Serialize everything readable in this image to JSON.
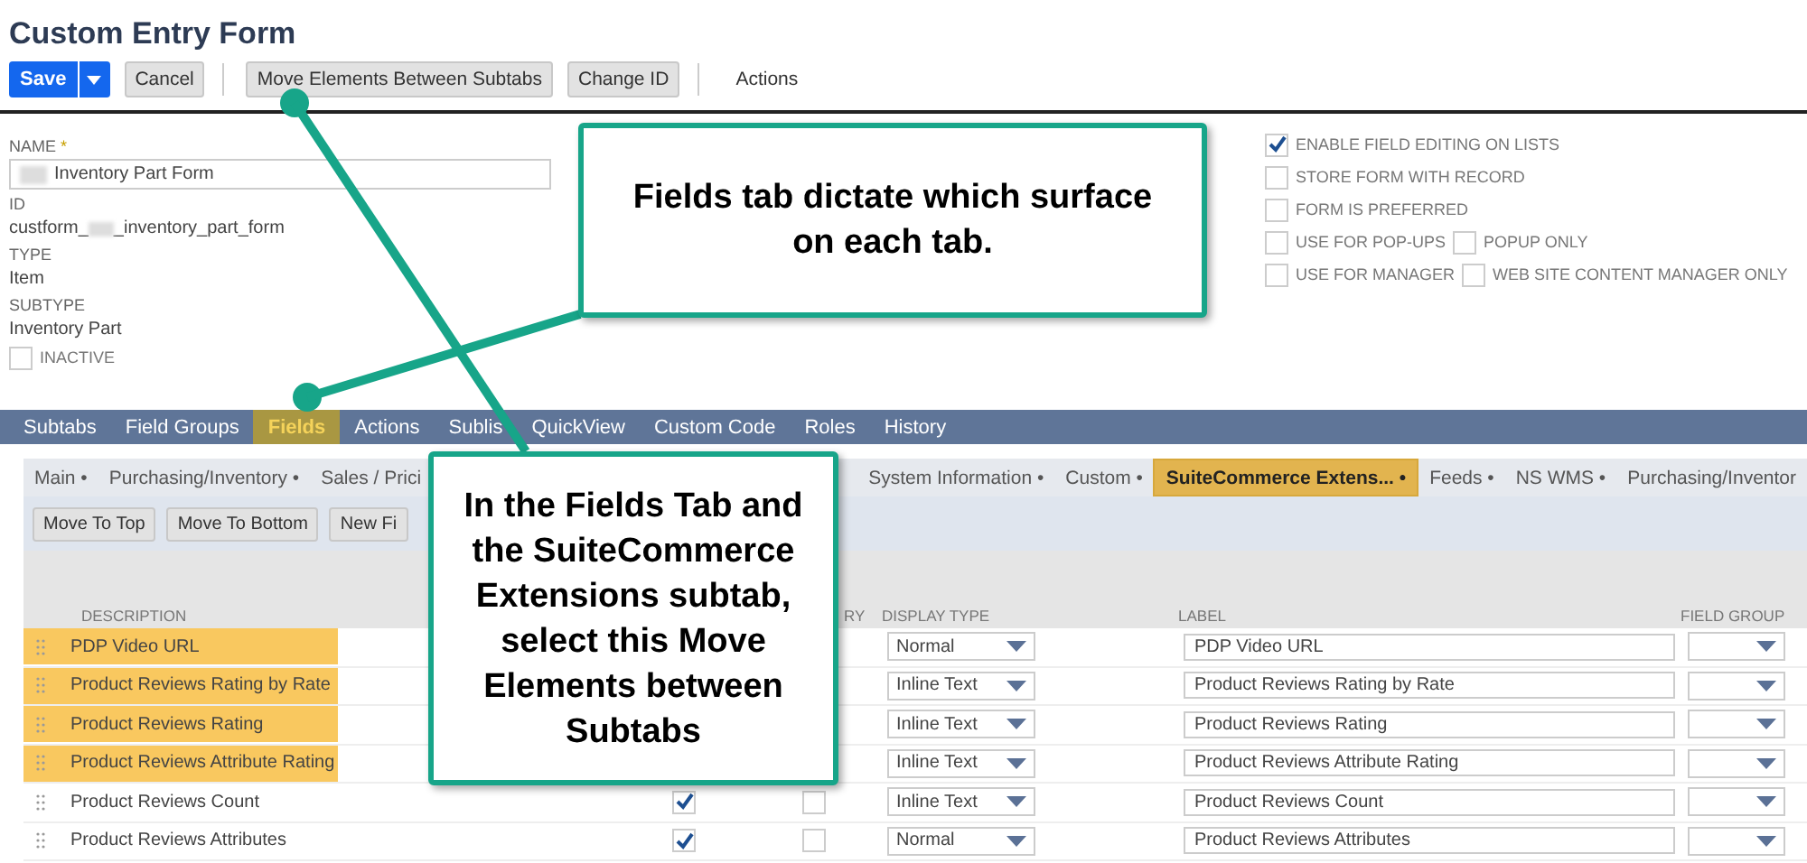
{
  "title": "Custom Entry Form",
  "toolbar": {
    "save": "Save",
    "buttons": [
      {
        "label": "Cancel",
        "kind": "button"
      },
      {
        "kind": "separator"
      },
      {
        "label": "Move Elements Between Subtabs",
        "kind": "button"
      },
      {
        "label": "Change ID",
        "kind": "button"
      },
      {
        "kind": "separator"
      },
      {
        "label": "Actions",
        "kind": "link"
      }
    ]
  },
  "form": {
    "name_label": "NAME",
    "required_mark": "*",
    "name_value": "Inventory Part Form",
    "id_label": "ID",
    "id_value_parts": [
      "custform_",
      "_inventory_part_form"
    ],
    "type_label": "TYPE",
    "type_value": "Item",
    "subtype_label": "SUBTYPE",
    "subtype_value": "Inventory Part",
    "inactive": {
      "label": "INACTIVE",
      "checked": false
    }
  },
  "options": [
    [
      {
        "label": "ENABLE FIELD EDITING ON LISTS",
        "checked": true
      }
    ],
    [
      {
        "label": "STORE FORM WITH RECORD",
        "checked": false
      }
    ],
    [
      {
        "label": "FORM IS PREFERRED",
        "checked": false
      }
    ],
    [
      {
        "label": "USE FOR POP-UPS",
        "checked": false
      },
      {
        "label": "POPUP ONLY",
        "checked": false
      }
    ],
    [
      {
        "label": "USE FOR MANAGER",
        "checked": false
      },
      {
        "label": "WEB SITE CONTENT MANAGER ONLY",
        "checked": false
      }
    ]
  ],
  "tabs": [
    {
      "label": "Subtabs",
      "selected": false
    },
    {
      "label": "Field Groups",
      "selected": false
    },
    {
      "label": "Fields",
      "selected": true
    },
    {
      "label": "Actions",
      "selected": false
    },
    {
      "label": "Sublis",
      "selected": false
    },
    {
      "label": "QuickView",
      "selected": false
    },
    {
      "label": "Custom Code",
      "selected": false
    },
    {
      "label": "Roles",
      "selected": false
    },
    {
      "label": "History",
      "selected": false
    }
  ],
  "subtabs_left": [
    {
      "label": "Main •",
      "selected": false
    },
    {
      "label": "Purchasing/Inventory •",
      "selected": false
    },
    {
      "label": "Sales / Prici",
      "selected": false
    }
  ],
  "subtabs_right": [
    {
      "label": "System Information •",
      "selected": false
    },
    {
      "label": "Custom •",
      "selected": false
    },
    {
      "label": "SuiteCommerce Extens... •",
      "selected": true
    },
    {
      "label": "Feeds •",
      "selected": false
    },
    {
      "label": "NS WMS •",
      "selected": false
    },
    {
      "label": "Purchasing/Inventor",
      "selected": false
    }
  ],
  "list_buttons": [
    "Move To Top",
    "Move To Bottom",
    "New Fi"
  ],
  "table": {
    "header": {
      "description": "DESCRIPTION",
      "column_3": "RY",
      "display_type": "DISPLAY TYPE",
      "label": "LABEL",
      "field_group": "FIELD GROUP"
    },
    "rows": [
      {
        "description": "PDP Video URL",
        "highlighted": true,
        "display_type": "Normal",
        "label": "PDP Video URL"
      },
      {
        "description": "Product Reviews Rating by Rate",
        "highlighted": true,
        "display_type": "Inline Text",
        "label": "Product Reviews Rating by Rate"
      },
      {
        "description": "Product Reviews Rating",
        "highlighted": true,
        "display_type": "Inline Text",
        "label": "Product Reviews Rating"
      },
      {
        "description": "Product Reviews Attribute Rating",
        "highlighted": true,
        "display_type": "Inline Text",
        "label": "Product Reviews Attribute Rating"
      },
      {
        "description": "Product Reviews Count",
        "highlighted": false,
        "column_2": true,
        "column_3": false,
        "display_type": "Inline Text",
        "label": "Product Reviews Count"
      },
      {
        "description": "Product Reviews Attributes",
        "highlighted": false,
        "column_2": true,
        "column_3": false,
        "display_type": "Normal",
        "label": "Product Reviews Attributes"
      }
    ]
  },
  "callouts": [
    "Fields tab dictate which surface on each tab.",
    "In the Fields Tab and the SuiteCommerce Extensions subtab, select this Move Elements between Subtabs"
  ]
}
